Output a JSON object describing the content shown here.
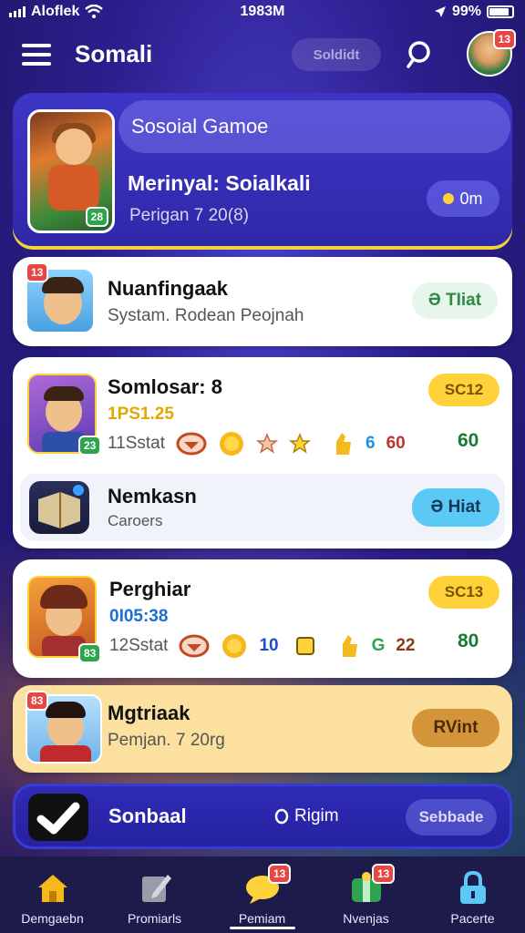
{
  "status_bar": {
    "carrier": "Aloflek",
    "time": "1983M",
    "battery": "99%"
  },
  "header": {
    "title": "Somali",
    "pill": "Soldidt",
    "avatar_badge": "13"
  },
  "featured": {
    "pill": "Sosoial Gamoe",
    "title": "Merinyal: Soialkali",
    "subtitle": "Perigan 7 20(8)",
    "button": "0m",
    "thumb_badge": "28"
  },
  "cards": [
    {
      "title": "Nuanfingaak",
      "subtitle": "Systam. Rodean Peojnah",
      "button": "Ə TIiat",
      "badge": "13"
    },
    {
      "title": "Somlosar: 8",
      "amount": "1PS1.25",
      "stat_label": "11Sstat",
      "tag": "SC12",
      "num1": "6",
      "num2": "60",
      "right": "60",
      "thumb_badge": "23"
    },
    {
      "title": "Nemkasn",
      "subtitle": "Caroers",
      "button": "Ə Hiat"
    },
    {
      "title": "Perghiar",
      "amount": "0I05:38",
      "stat_label": "12Sstat",
      "tag": "SC13",
      "num0": "10",
      "num1": "G",
      "num2": "22",
      "right": "80",
      "thumb_badge": "83"
    },
    {
      "title": "Mgtriaak",
      "subtitle": "Pemjan. 7 20rg",
      "button": "RVint",
      "badge": "83"
    }
  ],
  "search_strip": {
    "title": "Sonbaal",
    "middle": "Rigim",
    "button": "Sebbade"
  },
  "nav": [
    {
      "label": "Demgaebn",
      "icon": "home-icon"
    },
    {
      "label": "Promiarls",
      "icon": "edit-icon"
    },
    {
      "label": "Pemiam",
      "icon": "chat-icon",
      "badge": "13"
    },
    {
      "label": "Nvenjas",
      "icon": "gift-icon",
      "badge": "13"
    },
    {
      "label": "Pacerte",
      "icon": "lock-icon"
    }
  ],
  "colors": {
    "primary": "#2f28a8",
    "accent_yellow": "#f2d23a",
    "green": "#2ea44f",
    "blue_btn": "#5bc8f5"
  }
}
